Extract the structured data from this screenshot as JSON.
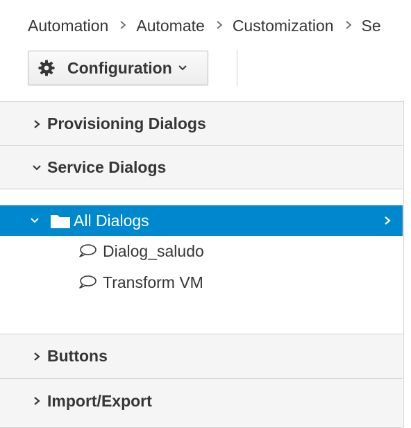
{
  "breadcrumb": {
    "items": [
      "Automation",
      "Automate",
      "Customization",
      "Se"
    ]
  },
  "toolbar": {
    "configuration_label": "Configuration",
    "configuration_icon": "gear-icon",
    "dropdown_icon": "chevron-down-icon"
  },
  "accordion": {
    "sections": [
      {
        "title": "Provisioning Dialogs",
        "expanded": false
      },
      {
        "title": "Service Dialogs",
        "expanded": true
      },
      {
        "title": "Buttons",
        "expanded": false
      },
      {
        "title": "Import/Export",
        "expanded": false
      }
    ],
    "tree": {
      "root": {
        "label": "All Dialogs",
        "icon": "folder-icon",
        "selected": true
      },
      "children": [
        {
          "label": "Dialog_saludo",
          "icon": "comment-icon"
        },
        {
          "label": "Transform VM",
          "icon": "comment-icon"
        }
      ]
    }
  },
  "colors": {
    "selection": "#0088ce",
    "header_bg": "#f5f5f5",
    "border": "#d1d1d1",
    "text": "#363636"
  }
}
